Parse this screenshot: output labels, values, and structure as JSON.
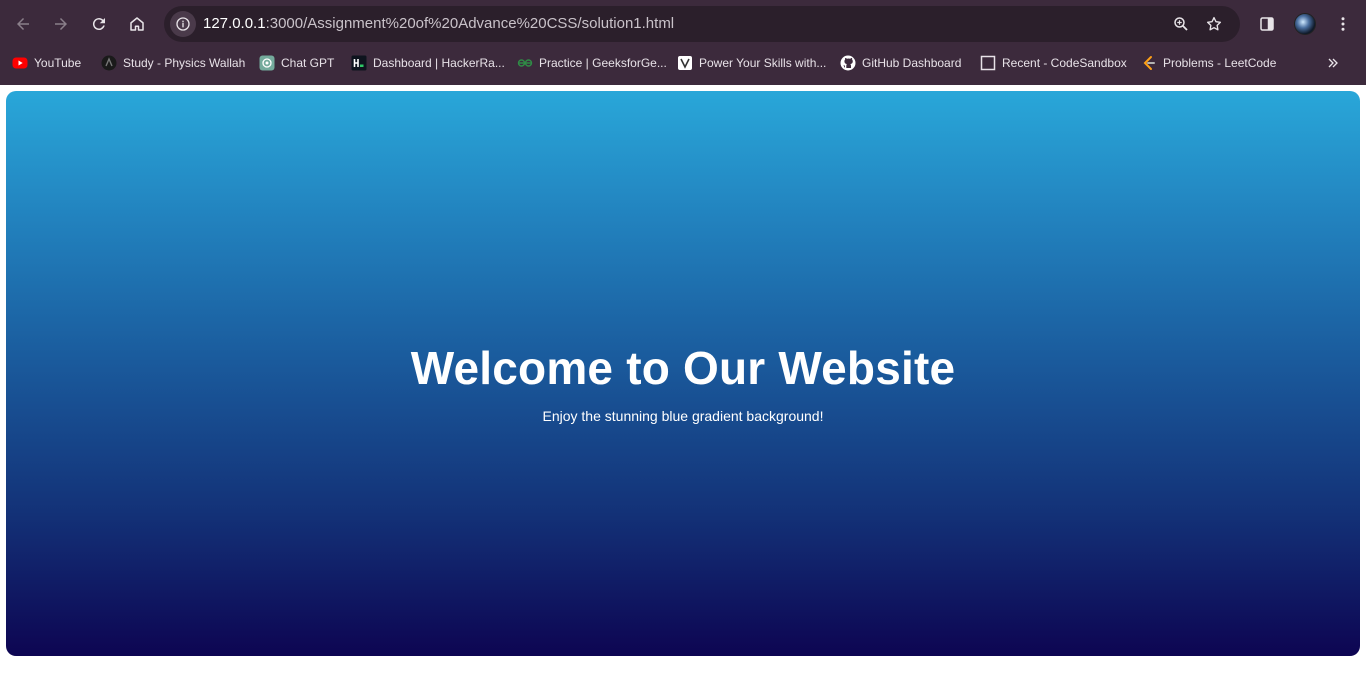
{
  "browser": {
    "url_host": "127.0.0.1",
    "url_path": ":3000/Assignment%20of%20Advance%20CSS/solution1.html",
    "colors": {
      "frame": "#3c2a3c",
      "omnibox": "#2b1f2b"
    },
    "icons": [
      "back-icon",
      "forward-icon",
      "reload-icon",
      "home-icon",
      "site-info-icon",
      "zoom-icon",
      "bookmark-star-icon",
      "side-panel-icon",
      "profile-avatar",
      "menu-icon"
    ]
  },
  "bookmarks": [
    {
      "label": "YouTube",
      "icon": "youtube-icon"
    },
    {
      "label": "Study - Physics Wallah",
      "icon": "physics-wallah-icon"
    },
    {
      "label": "Chat GPT",
      "icon": "chatgpt-icon"
    },
    {
      "label": "Dashboard | HackerRa...",
      "icon": "hackerrank-icon"
    },
    {
      "label": "Practice | GeeksforGe...",
      "icon": "geeksforgeeks-icon"
    },
    {
      "label": "Power Your Skills with...",
      "icon": "page-icon"
    },
    {
      "label": "GitHub Dashboard",
      "icon": "github-icon"
    },
    {
      "label": "Recent - CodeSandbox",
      "icon": "codesandbox-icon"
    },
    {
      "label": "Problems - LeetCode",
      "icon": "leetcode-icon"
    }
  ],
  "page": {
    "title": "Welcome to Our Website",
    "subtitle": "Enjoy the stunning blue gradient background!",
    "gradient_colors": [
      "#29a7d9",
      "#0d0552"
    ]
  }
}
